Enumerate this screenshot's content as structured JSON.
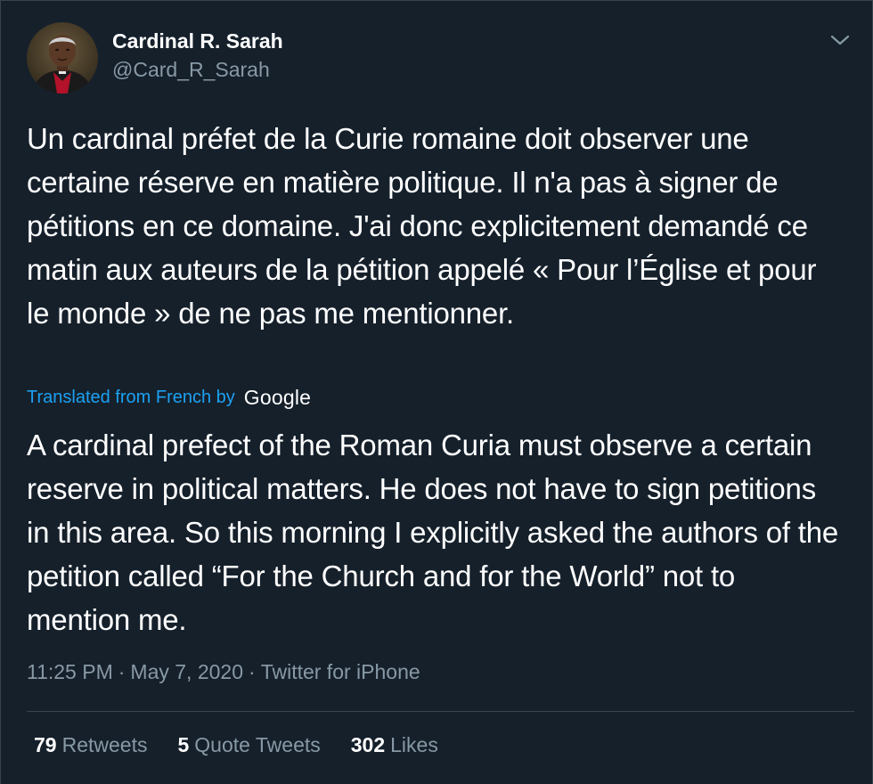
{
  "colors": {
    "background": "#15202b",
    "primary_text": "#ffffff",
    "secondary_text": "#8899a6",
    "link": "#1da1f2",
    "divider": "#38444d"
  },
  "author": {
    "name": "Cardinal R. Sarah",
    "handle": "@Card_R_Sarah",
    "avatar_icon": "profile-photo"
  },
  "menu": {
    "icon": "chevron-down-icon"
  },
  "tweet": {
    "original_text": "Un cardinal préfet de la Curie romaine doit observer une certaine réserve en matière politique. Il n'a pas à signer de pétitions en ce domaine. J'ai donc explicitement demandé ce matin aux auteurs de la pétition appelé « Pour l’Église et pour le monde » de ne pas me mentionner.",
    "translation_label": "Translated from French by",
    "translation_provider": "Google",
    "translated_text": "A cardinal prefect of the Roman Curia must observe a certain reserve in political matters. He does not have to sign petitions in this area. So this morning I explicitly asked the authors of the petition called “For the Church and for the World” not to mention me."
  },
  "meta": {
    "time": "11:25 PM",
    "separator": "·",
    "date": "May 7, 2020",
    "source": "Twitter for iPhone"
  },
  "stats": {
    "retweets_count": "79",
    "retweets_label": "Retweets",
    "quotes_count": "5",
    "quotes_label": "Quote Tweets",
    "likes_count": "302",
    "likes_label": "Likes"
  }
}
